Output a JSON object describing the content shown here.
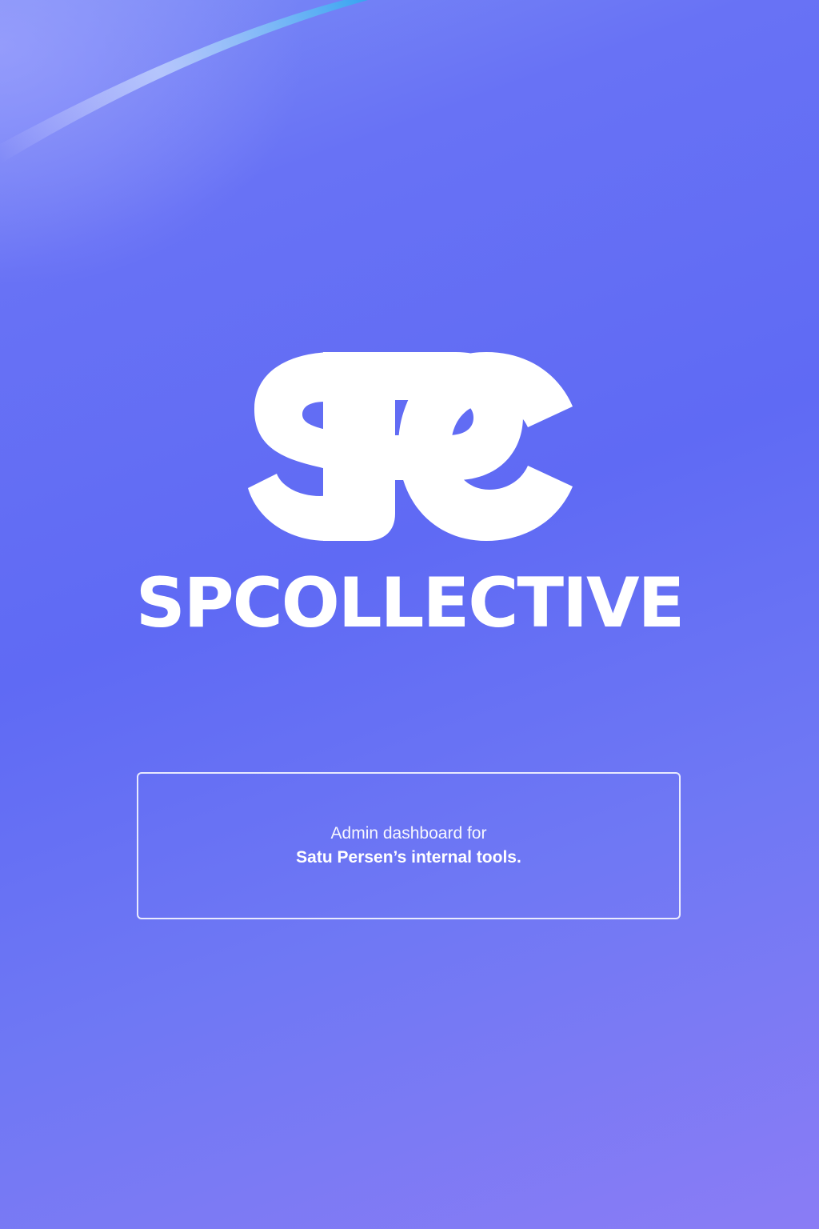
{
  "brand": {
    "logo_icon": "spc-monogram-logo",
    "logo_text": "SPC",
    "wordmark": "SPCOLLECTIVE"
  },
  "info_box": {
    "line1": "Admin dashboard for",
    "line2": "Satu Persen’s internal tools."
  },
  "colors": {
    "background_start": "#7d8ef6",
    "background_mid": "#5f6af4",
    "background_end": "#8a7cf5",
    "foreground": "#ffffff"
  }
}
